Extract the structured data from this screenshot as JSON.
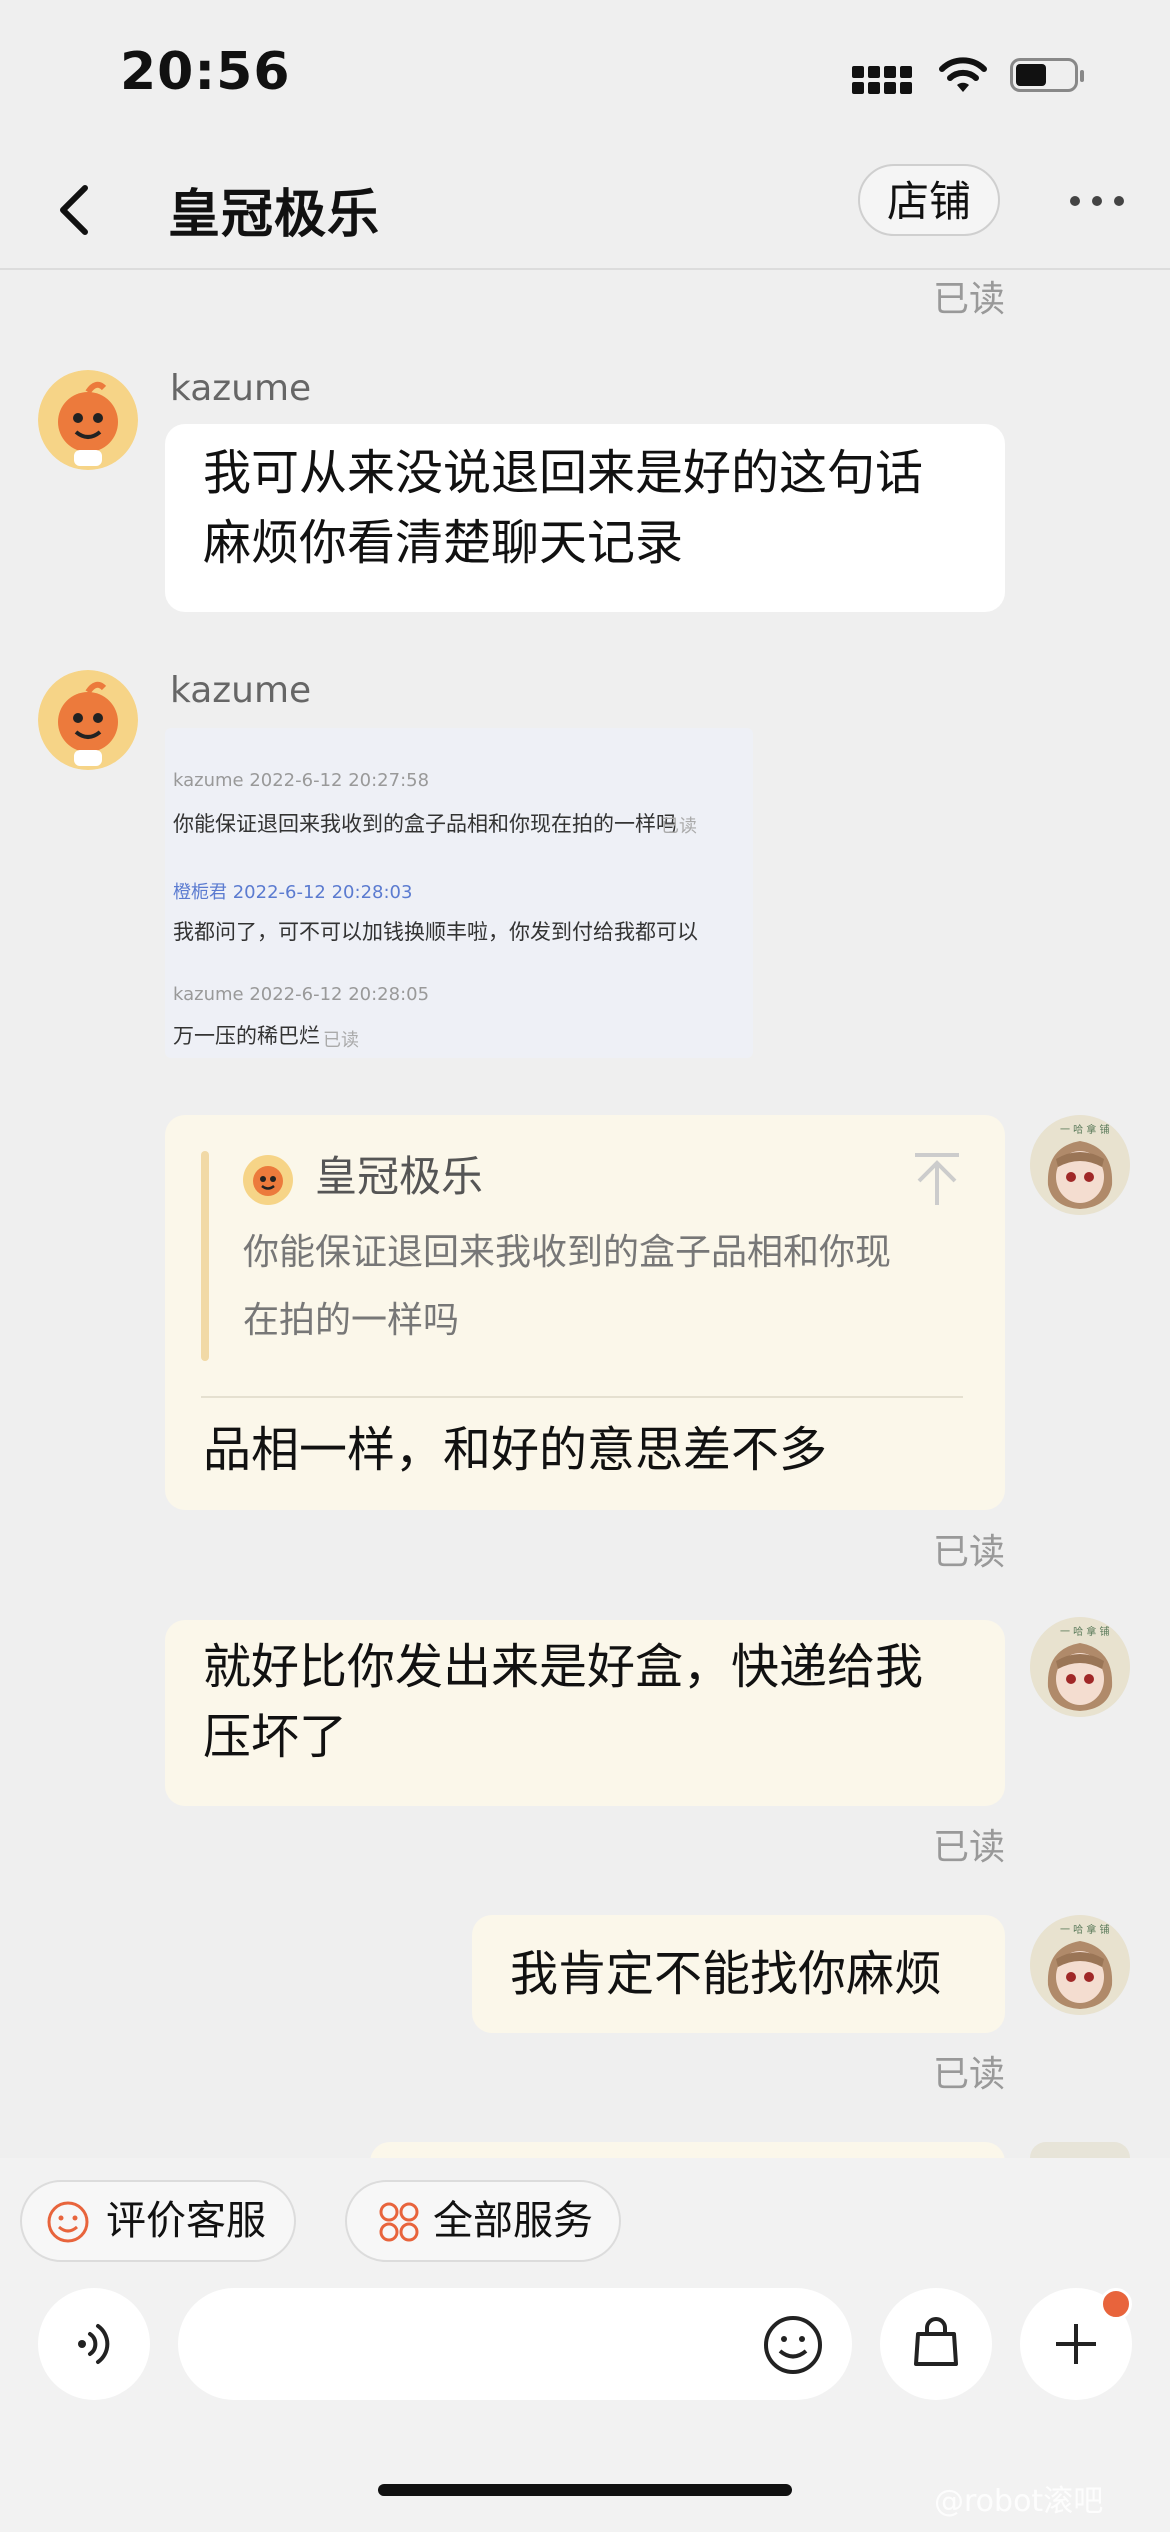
{
  "status_bar": {
    "time": "20:56"
  },
  "nav": {
    "title": "皇冠极乐",
    "shop_button": "店铺"
  },
  "messages": {
    "read_label": "已读",
    "m1": {
      "sender": "kazume",
      "text_line1": "我可从来没说退回来是好的这句话",
      "text_line2": "麻烦你看清楚聊天记录"
    },
    "m2": {
      "sender": "kazume",
      "screenshot": {
        "row1_meta": "kazume   2022-6-12 20:27:58",
        "row1_text": "你能保证退回来我收到的盒子品相和你现在拍的一样吗",
        "row1_read": "已读",
        "row2_meta": "橙栀君   2022-6-12 20:28:03",
        "row2_text": "我都问了，可不可以加钱换顺丰啦，你发到付给我都可以",
        "row3_meta": "kazume   2022-6-12 20:28:05",
        "row3_text": "万一压的稀巴烂",
        "row3_read": "已读"
      }
    },
    "m3": {
      "quote_name": "皇冠极乐",
      "quote_line1": "你能保证退回来我收到的盒子品相和你现",
      "quote_line2": "在拍的一样吗",
      "reply": "品相一样，和好的意思差不多"
    },
    "m4": {
      "line1": "就好比你发出来是好盒，快递给我",
      "line2": "压坏了"
    },
    "m5": {
      "text": "我肯定不能找你麻烦"
    }
  },
  "bottom": {
    "rate_label": "评价客服",
    "services_label": "全部服务",
    "watermark": "@robot滚吧"
  },
  "colors": {
    "accent": "#e8643c",
    "cream_bubble": "#fbf7ea",
    "background": "#efefef"
  }
}
